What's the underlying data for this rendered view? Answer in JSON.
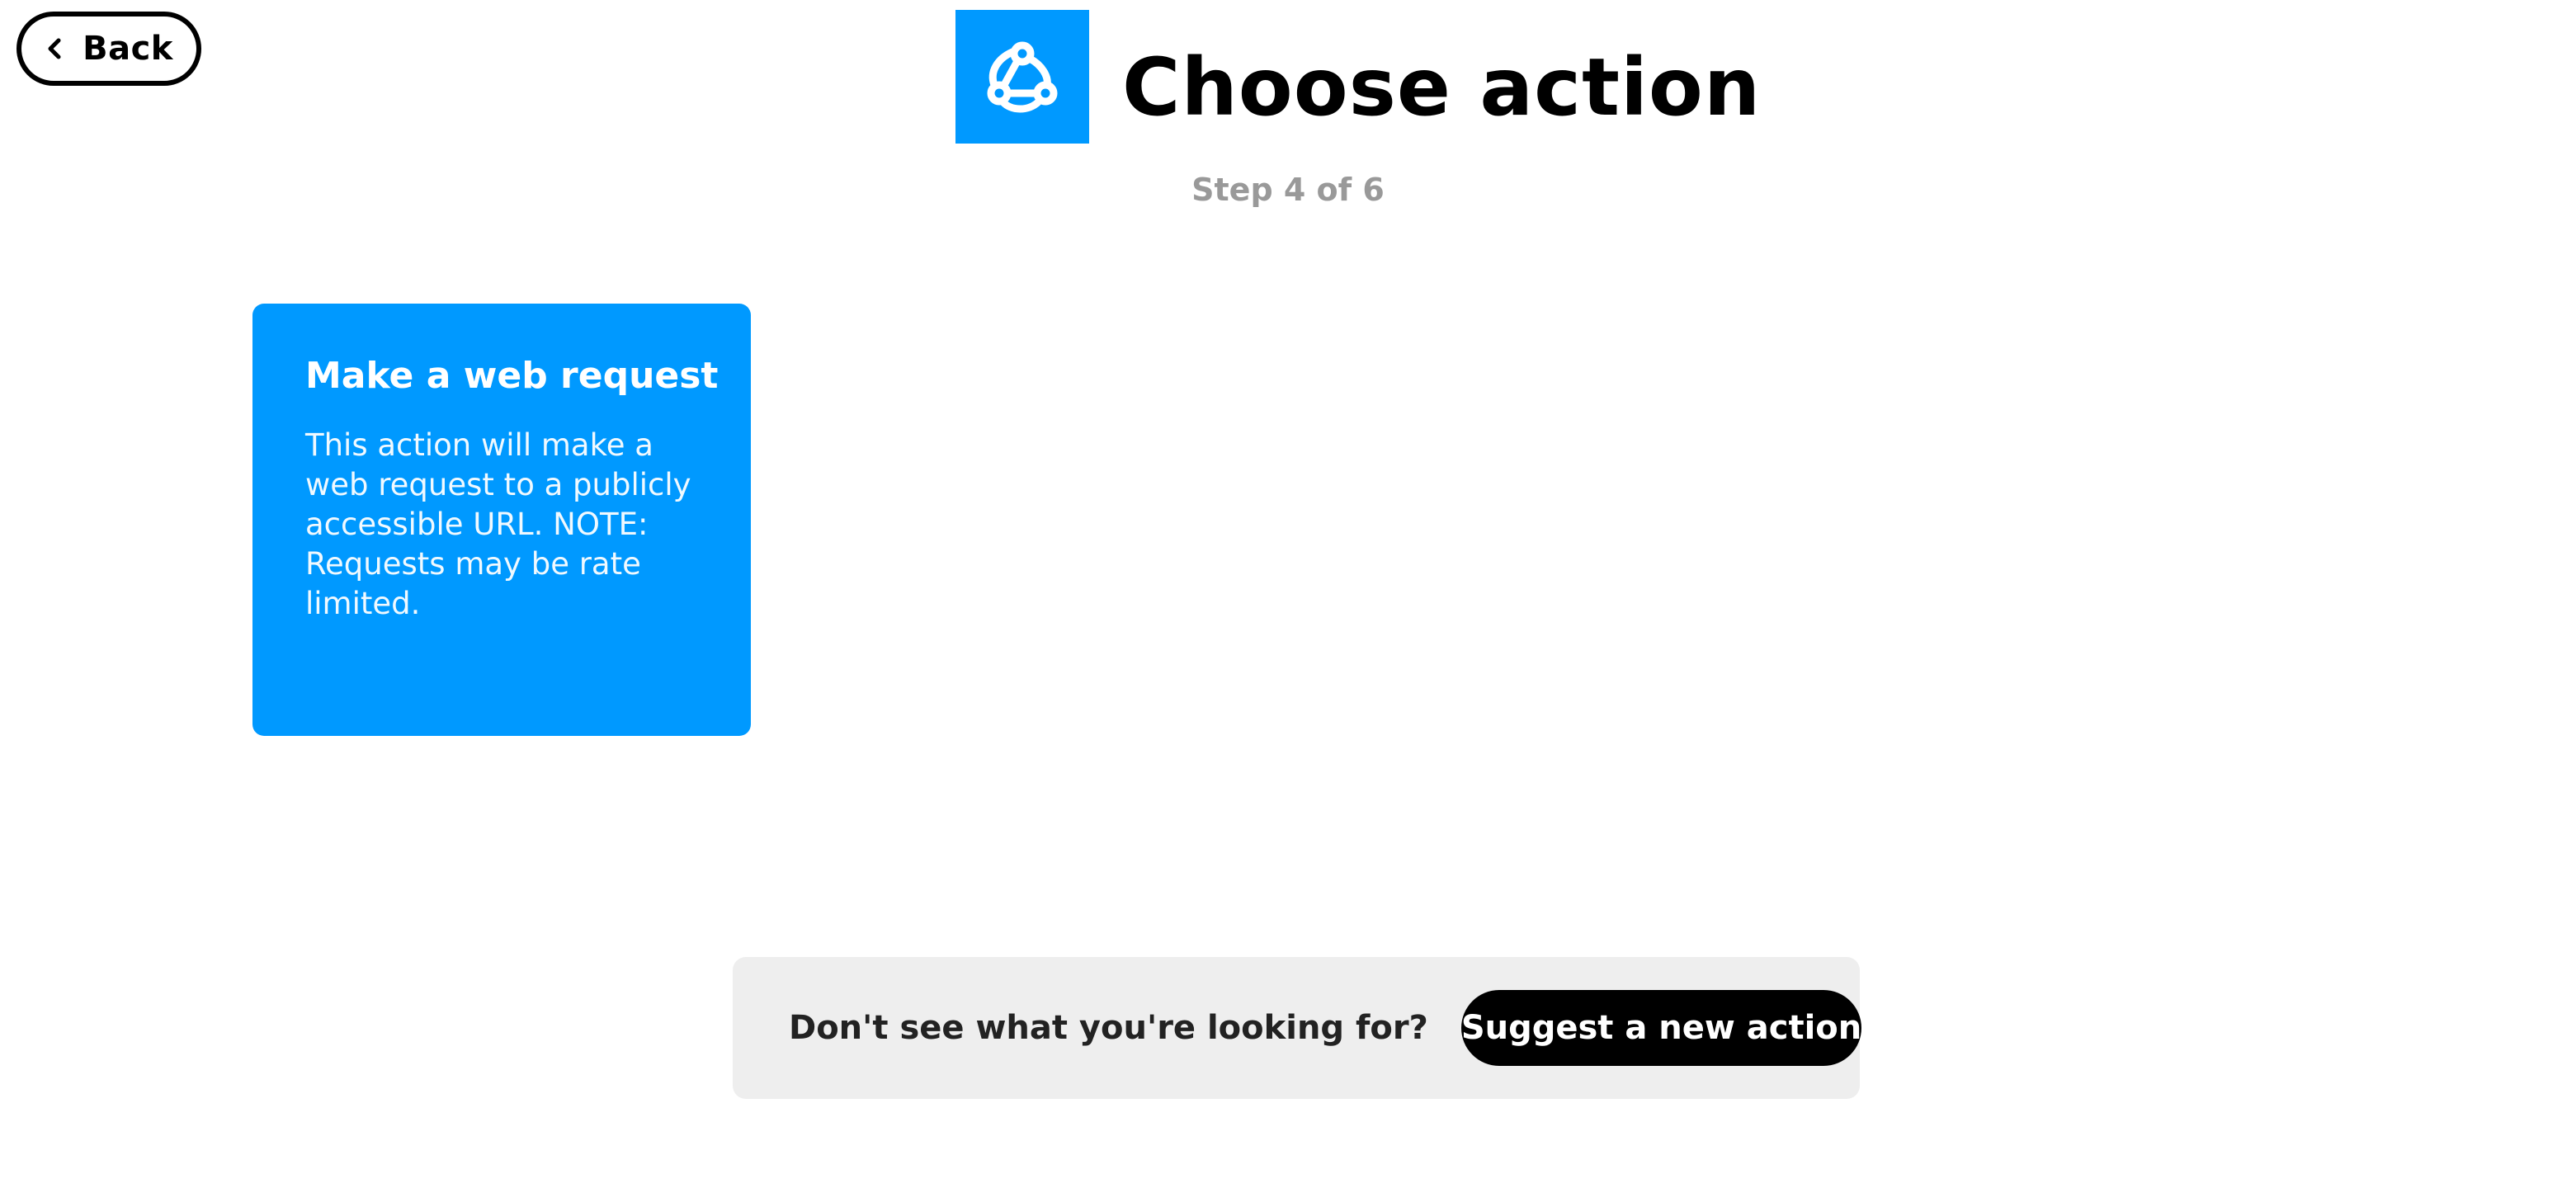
{
  "nav": {
    "back_label": "Back",
    "back_icon": "chevron-left-icon"
  },
  "header": {
    "service_icon": "webhook-icon",
    "title": "Choose action",
    "step": "Step 4 of 6"
  },
  "actions": [
    {
      "title": "Make a web request",
      "description": "This action will make a web request to a publicly accessible URL. NOTE: Requests may be rate limited."
    }
  ],
  "suggest": {
    "prompt": "Don't see what you're looking for?",
    "button_label": "Suggest a new action"
  },
  "colors": {
    "brand": "#0099ff",
    "button_dark": "#000000",
    "suggest_bg": "#eeeeee",
    "muted_text": "#999999"
  }
}
